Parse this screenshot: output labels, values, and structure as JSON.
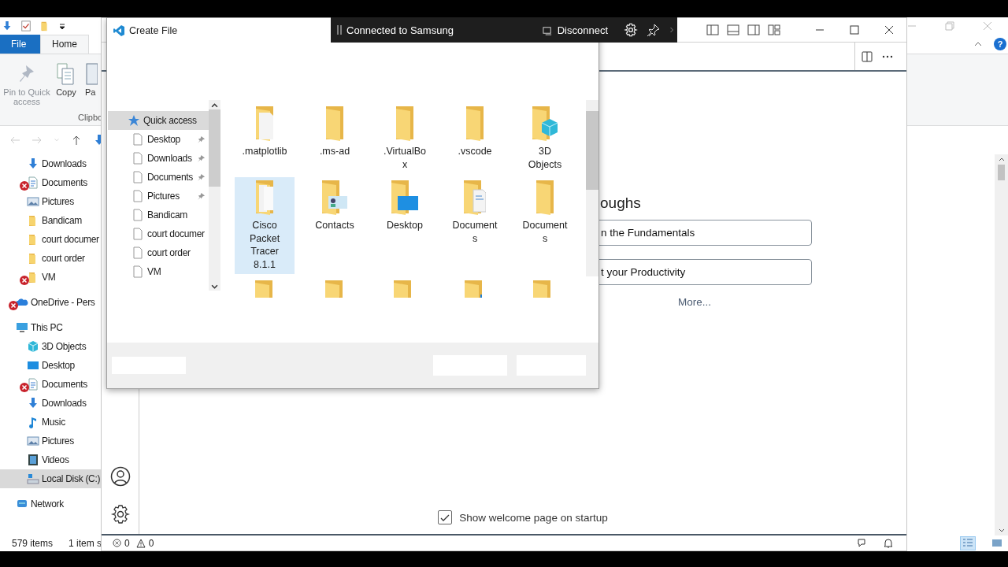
{
  "explorer": {
    "ribbon_tabs": [
      {
        "label": "File",
        "kind": "file",
        "selected": false
      },
      {
        "label": "Home",
        "kind": "tab",
        "selected": true
      }
    ],
    "ribbon_buttons": [
      {
        "label": "Pin to Quick access",
        "kind": "pin",
        "disabled": true
      },
      {
        "label": "Copy",
        "kind": "copy",
        "disabled": false
      },
      {
        "label": "Pa",
        "kind": "paste",
        "disabled": false
      }
    ],
    "ribbon_group": "Clipbo",
    "help_button": "?",
    "nav": [
      {
        "children": [
          {
            "label": "Downloads",
            "kind": "download",
            "error": false,
            "selected": false
          },
          {
            "label": "Documents",
            "kind": "document",
            "error": true,
            "selected": false
          },
          {
            "label": "Pictures",
            "kind": "picture",
            "error": false,
            "selected": false
          },
          {
            "label": "Bandicam",
            "kind": "folder",
            "error": false,
            "selected": false
          },
          {
            "label": "court documer",
            "kind": "folder",
            "error": false,
            "selected": false
          },
          {
            "label": "court order",
            "kind": "folder",
            "error": false,
            "selected": false
          },
          {
            "label": "VM",
            "kind": "folder",
            "error": true,
            "selected": false
          }
        ]
      },
      {
        "label": "OneDrive - Pers",
        "kind": "cloud",
        "error": true,
        "selected": false
      },
      {
        "label": "This PC",
        "kind": "pc",
        "error": false,
        "selected": false,
        "children": [
          {
            "label": "3D Objects",
            "kind": "cube",
            "error": false,
            "selected": false
          },
          {
            "label": "Desktop",
            "kind": "desktop",
            "error": false,
            "selected": false
          },
          {
            "label": "Documents",
            "kind": "document",
            "error": true,
            "selected": false
          },
          {
            "label": "Downloads",
            "kind": "download",
            "error": false,
            "selected": false
          },
          {
            "label": "Music",
            "kind": "music",
            "error": false,
            "selected": false
          },
          {
            "label": "Pictures",
            "kind": "picture",
            "error": false,
            "selected": false
          },
          {
            "label": "Videos",
            "kind": "video",
            "error": false,
            "selected": false
          },
          {
            "label": "Local Disk (C:)",
            "kind": "disk",
            "error": false,
            "selected": true
          }
        ]
      },
      {
        "label": "Network",
        "kind": "network",
        "error": false,
        "selected": false
      }
    ],
    "status_bar": {
      "items": "579 items",
      "selection": "1 item s"
    }
  },
  "vscode": {
    "welcome": {
      "heading": "oughs",
      "walkthroughs": [
        "n the Fundamentals",
        "t your Productivity"
      ],
      "more": "More...",
      "startup_checkbox": {
        "label": "Show welcome page on startup",
        "checked": true
      }
    },
    "status_bar": {
      "errors": "0",
      "warnings": "0"
    }
  },
  "dialog": {
    "title": "Create File",
    "nav": [
      {
        "label": "Quick access",
        "kind": "star",
        "selected": true,
        "children": [
          {
            "label": "Desktop",
            "kind": "page",
            "pinned": true,
            "selected": false
          },
          {
            "label": "Downloads",
            "kind": "page",
            "pinned": true,
            "selected": false
          },
          {
            "label": "Documents",
            "kind": "page",
            "pinned": true,
            "selected": false
          },
          {
            "label": "Pictures",
            "kind": "page",
            "pinned": true,
            "selected": false
          },
          {
            "label": "Bandicam",
            "kind": "page",
            "pinned": false,
            "selected": false
          },
          {
            "label": "court documer",
            "kind": "page",
            "pinned": false,
            "selected": false
          },
          {
            "label": "court order",
            "kind": "page",
            "pinned": false,
            "selected": false
          },
          {
            "label": "VM",
            "kind": "page",
            "pinned": false,
            "selected": false
          }
        ]
      }
    ],
    "items": [
      {
        "label": ".matplotlib",
        "kind": "doc",
        "selected": false
      },
      {
        "label": ".ms-ad",
        "kind": "plain",
        "selected": false
      },
      {
        "label": ".VirtualBox",
        "kind": "plain",
        "selected": false
      },
      {
        "label": ".vscode",
        "kind": "plain",
        "selected": false
      },
      {
        "label": "3D Objects",
        "kind": "cube",
        "selected": false
      },
      {
        "label": "Cisco Packet Tracer 8.1.1",
        "kind": "pages",
        "selected": true
      },
      {
        "label": "Contacts",
        "kind": "contacts",
        "selected": false
      },
      {
        "label": "Desktop",
        "kind": "desktop",
        "selected": false
      },
      {
        "label": "Documents",
        "kind": "documents",
        "selected": false
      },
      {
        "label": "Documents",
        "kind": "plain",
        "selected": false
      },
      {
        "kind": "square",
        "selected": false
      },
      {
        "kind": "pencil",
        "selected": false
      },
      {
        "kind": "arrow",
        "selected": false
      },
      {
        "kind": "music",
        "selected": false
      },
      {
        "kind": "globe",
        "selected": false
      }
    ]
  },
  "remote_bar": {
    "connection": "Connected to Samsung",
    "action": "Disconnect"
  }
}
